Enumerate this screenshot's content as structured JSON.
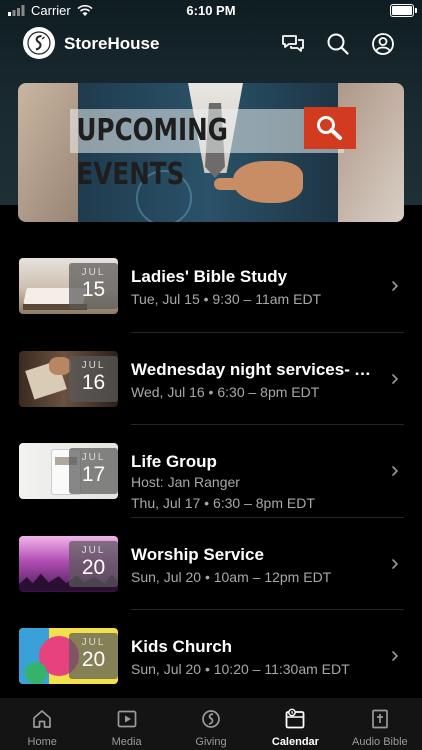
{
  "status_bar": {
    "carrier": "Carrier",
    "time": "6:10 PM"
  },
  "header": {
    "app_title": "StoreHouse"
  },
  "banner": {
    "text": "UPCOMING EVENTS"
  },
  "events": [
    {
      "title": "Ladies' Bible Study",
      "month": "JUL",
      "day": "15",
      "host": "",
      "datetime": "Tue, Jul 15 • 9:30 – 11am EDT",
      "thumb": "bible"
    },
    {
      "title": "Wednesday night services- Ad...",
      "month": "JUL",
      "day": "16",
      "host": "",
      "datetime": "Wed, Jul 16 • 6:30 – 8pm EDT",
      "thumb": "reading"
    },
    {
      "title": "Life Group",
      "month": "JUL",
      "day": "17",
      "host": "Host: Jan Ranger",
      "datetime": "Thu, Jul 17 • 6:30 – 8pm EDT",
      "thumb": "mug"
    },
    {
      "title": "Worship Service",
      "month": "JUL",
      "day": "20",
      "host": "",
      "datetime": "Sun, Jul 20 • 10am – 12pm EDT",
      "thumb": "worship"
    },
    {
      "title": "Kids Church",
      "month": "JUL",
      "day": "20",
      "host": "",
      "datetime": "Sun, Jul 20 • 10:20 – 11:30am EDT",
      "thumb": "kids"
    }
  ],
  "tabs": [
    {
      "label": "Home",
      "icon": "home-icon",
      "active": false
    },
    {
      "label": "Media",
      "icon": "media-icon",
      "active": false
    },
    {
      "label": "Giving",
      "icon": "giving-icon",
      "active": false
    },
    {
      "label": "Calendar",
      "icon": "calendar-icon",
      "active": true
    },
    {
      "label": "Audio Bible",
      "icon": "audio-bible-icon",
      "active": false
    }
  ],
  "colors": {
    "accent_red": "#d33b20",
    "background": "#000000",
    "secondary_text": "#a8a8a8"
  }
}
